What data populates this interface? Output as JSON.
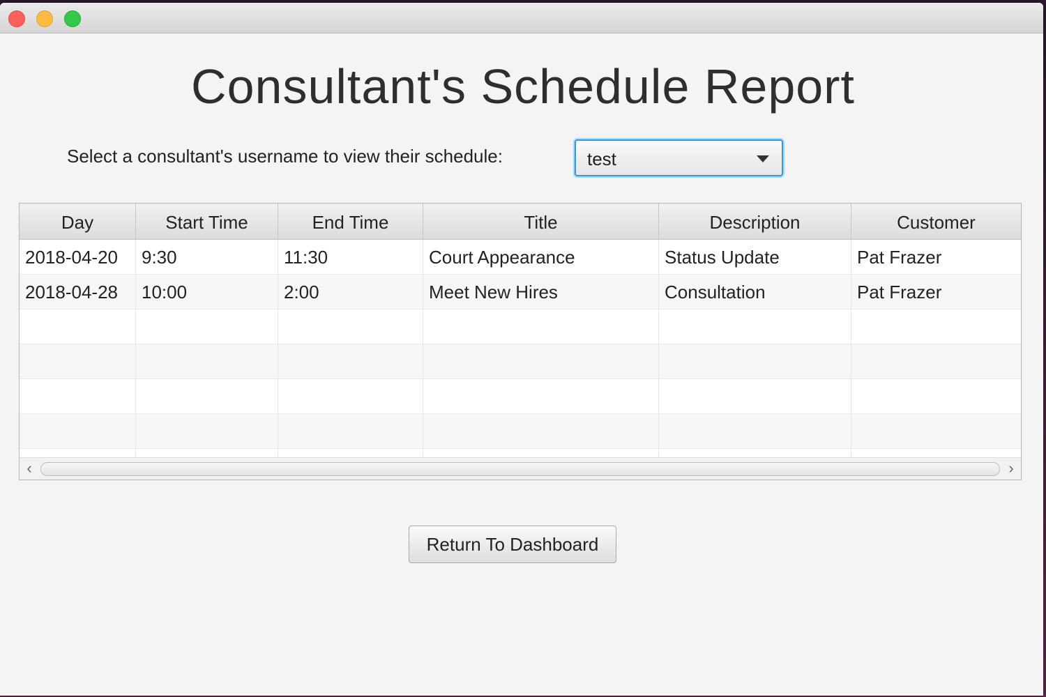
{
  "window": {
    "title": ""
  },
  "heading": "Consultant's Schedule Report",
  "selector": {
    "label": "Select a consultant's username to view their schedule:",
    "value": "test"
  },
  "table": {
    "columns": [
      "Day",
      "Start Time",
      "End Time",
      "Title",
      "Description",
      "Customer"
    ],
    "rows": [
      [
        "2018-04-20",
        "9:30",
        "11:30",
        "Court Appearance",
        "Status Update",
        "Pat Frazer"
      ],
      [
        "2018-04-28",
        "10:00",
        "2:00",
        "Meet New Hires",
        "Consultation",
        "Pat Frazer"
      ],
      [
        "",
        "",
        "",
        "",
        "",
        ""
      ],
      [
        "",
        "",
        "",
        "",
        "",
        ""
      ],
      [
        "",
        "",
        "",
        "",
        "",
        ""
      ],
      [
        "",
        "",
        "",
        "",
        "",
        ""
      ],
      [
        "",
        "",
        "",
        "",
        "",
        ""
      ]
    ]
  },
  "scrollbar": {
    "left_icon": "chevron-left-icon",
    "right_icon": "chevron-right-icon"
  },
  "buttons": {
    "return_label": "Return To Dashboard"
  },
  "colors": {
    "close": "#fc605c",
    "minimize": "#fdbc40",
    "maximize": "#34c84a",
    "focus_ring": "#2a9fe0"
  }
}
